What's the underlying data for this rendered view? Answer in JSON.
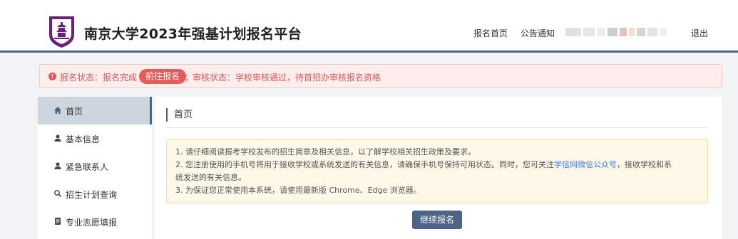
{
  "header": {
    "title": "南京大学2023年强基计划报名平台",
    "nav_home": "报名首页",
    "nav_notice": "公告通知",
    "nav_logout": "退出"
  },
  "status": {
    "signup_label": "报名状态：报名完成",
    "goto_button": "前往报名",
    "separator": "；",
    "review_text": "审核状态：学校审核通过，待首招办审核报名资格"
  },
  "sidebar": {
    "items": [
      {
        "label": "首页",
        "icon": "home-icon"
      },
      {
        "label": "基本信息",
        "icon": "user-icon"
      },
      {
        "label": "紧急联系人",
        "icon": "user-icon"
      },
      {
        "label": "招生计划查询",
        "icon": "search-icon"
      },
      {
        "label": "专业志愿填报",
        "icon": "form-icon"
      }
    ]
  },
  "main": {
    "title": "首页",
    "notice": {
      "line1": "1. 请仔细阅读报考学校发布的招生简章及相关信息，以了解学校相关招生政策及要求。",
      "line2_pre": "2. 您注册使用的手机号将用于接收学校或系统发送的有关信息，请确保手机号保持可用状态。同时，您可关注",
      "line2_link": "学信网微信公众号",
      "line2_post": "，接收学校和系",
      "line3": "统发送的有关信息。",
      "line4": "3. 为保证您正常使用本系统，请使用最新版 Chrome、Edge 浏览器。"
    },
    "continue_button": "继续报名"
  },
  "colors": {
    "brand_primary": "#4d6387",
    "logo_purple": "#6b1f7a",
    "alert_red": "#e05555",
    "link_blue": "#3a7fd6"
  }
}
